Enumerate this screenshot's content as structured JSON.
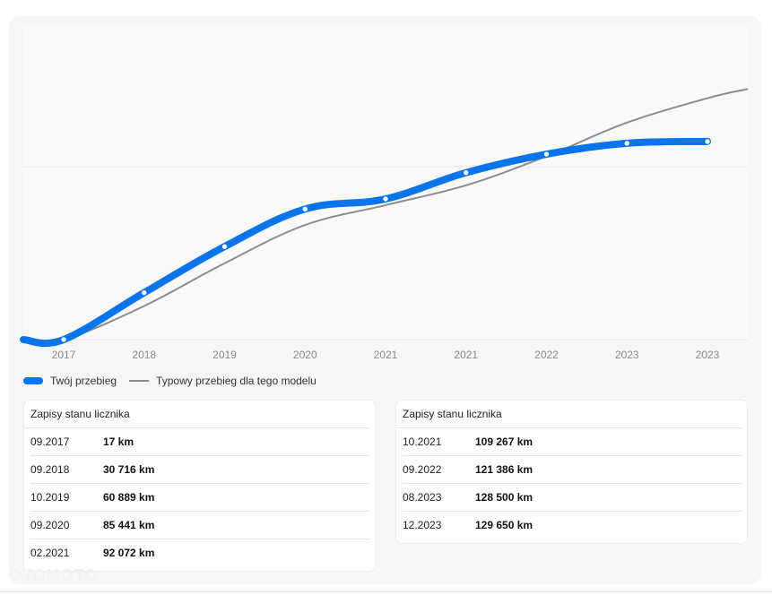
{
  "chart_data": {
    "type": "line",
    "x": [
      "2017",
      "2018",
      "2019",
      "2020",
      "2021",
      "2021",
      "2022",
      "2023",
      "2023"
    ],
    "ylim": [
      0,
      200000
    ],
    "grid": true,
    "legend_position": "bottom-left",
    "series": [
      {
        "name": "Twój przebieg",
        "color": "#0a74ea",
        "values": [
          17,
          30716,
          60889,
          85441,
          92072,
          109267,
          121386,
          128500,
          129650
        ]
      },
      {
        "name": "Typowy przebieg dla tego modelu",
        "color": "#8c8c8c",
        "values": [
          17,
          22000,
          50000,
          75000,
          88000,
          101000,
          120000,
          142000,
          158000
        ]
      }
    ]
  },
  "legend": {
    "yours_label": "Twój przebieg",
    "typical_label": "Typowy przebieg dla tego modelu"
  },
  "tables": {
    "left": {
      "title": "Zapisy stanu licznika",
      "rows": [
        {
          "date": "09.2017",
          "km": "17 km"
        },
        {
          "date": "09.2018",
          "km": "30 716 km"
        },
        {
          "date": "10.2019",
          "km": "60 889 km"
        },
        {
          "date": "09.2020",
          "km": "85 441 km"
        },
        {
          "date": "02.2021",
          "km": "92 072 km"
        }
      ]
    },
    "right": {
      "title": "Zapisy stanu licznika",
      "rows": [
        {
          "date": "10.2021",
          "km": "109 267 km"
        },
        {
          "date": "09.2022",
          "km": "121 386 km"
        },
        {
          "date": "08.2023",
          "km": "128 500 km"
        },
        {
          "date": "12.2023",
          "km": "129 650 km"
        }
      ]
    }
  },
  "watermark": "OTOMOTO"
}
